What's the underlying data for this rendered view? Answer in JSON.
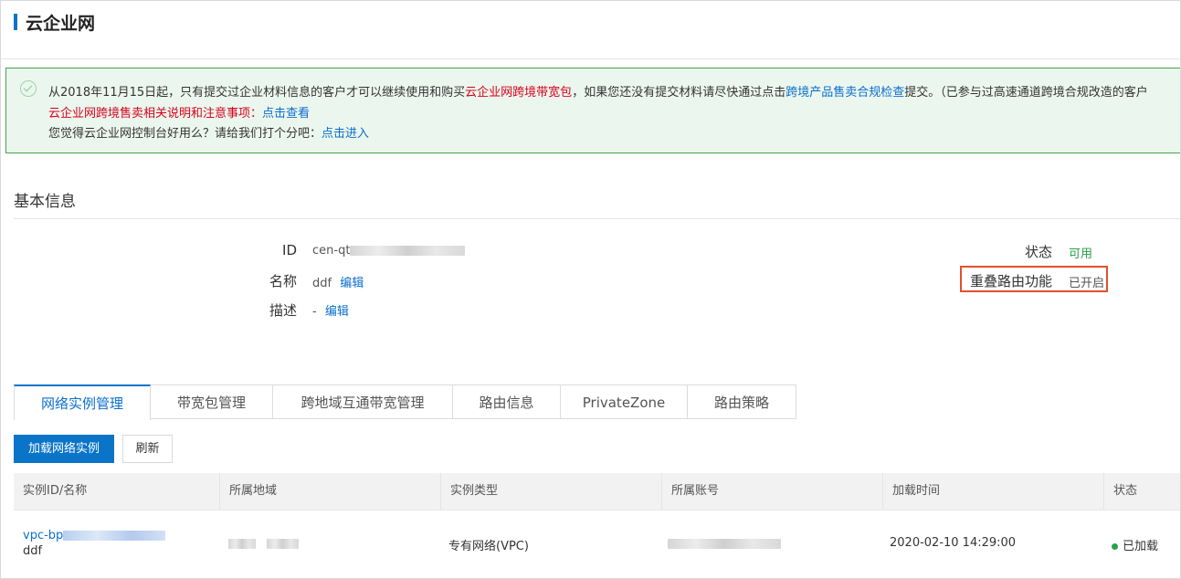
{
  "page": {
    "title": "云企业网"
  },
  "notice": {
    "line1_a": "从2018年11月15日起，只有提交过企业材料信息的客户才可以继续使用和购买",
    "line1_red": "云企业网跨境带宽包",
    "line1_b": "，如果您还没有提交材料请尽快通过点击",
    "line1_link": "跨境产品售卖合规检查",
    "line1_c": "提交。（已参与过高速通道跨境合规改造的客户",
    "line2_red": "云企业网跨境售卖相关说明和注意事项：",
    "line2_link": "点击查看",
    "line3_text": "您觉得云企业网控制台好用么？请给我们打个分吧：",
    "line3_link": "点击进入"
  },
  "basic_info": {
    "section_title": "基本信息",
    "id_label": "ID",
    "id_value": "cen-qt",
    "name_label": "名称",
    "name_value": "ddf",
    "name_edit": "编辑",
    "desc_label": "描述",
    "desc_value": "-",
    "desc_edit": "编辑",
    "status_label": "状态",
    "status_value": "可用",
    "overlap_label": "重叠路由功能",
    "overlap_value": "已开启"
  },
  "tabs": [
    {
      "label": "网络实例管理",
      "active": true
    },
    {
      "label": "带宽包管理",
      "active": false
    },
    {
      "label": "跨地域互通带宽管理",
      "active": false
    },
    {
      "label": "路由信息",
      "active": false
    },
    {
      "label": "PrivateZone",
      "active": false
    },
    {
      "label": "路由策略",
      "active": false
    }
  ],
  "toolbar": {
    "load_instance": "加载网络实例",
    "refresh": "刷新"
  },
  "table": {
    "columns": [
      "实例ID/名称",
      "所属地域",
      "实例类型",
      "所属账号",
      "加载时间",
      "状态"
    ],
    "rows": [
      {
        "instance_id": "vpc-bp",
        "instance_name": "ddf",
        "region": "",
        "type": "专有网络(VPC)",
        "account": "",
        "load_time": "2020-02-10 14:29:00",
        "status": "已加载"
      }
    ]
  },
  "colors": {
    "accent": "#0a74c9",
    "link": "#0b6ecf",
    "warning_red": "#d9001b",
    "success_green": "#2ba14b",
    "notice_bg": "#ebf7ee",
    "highlight_border": "#e0502f"
  }
}
